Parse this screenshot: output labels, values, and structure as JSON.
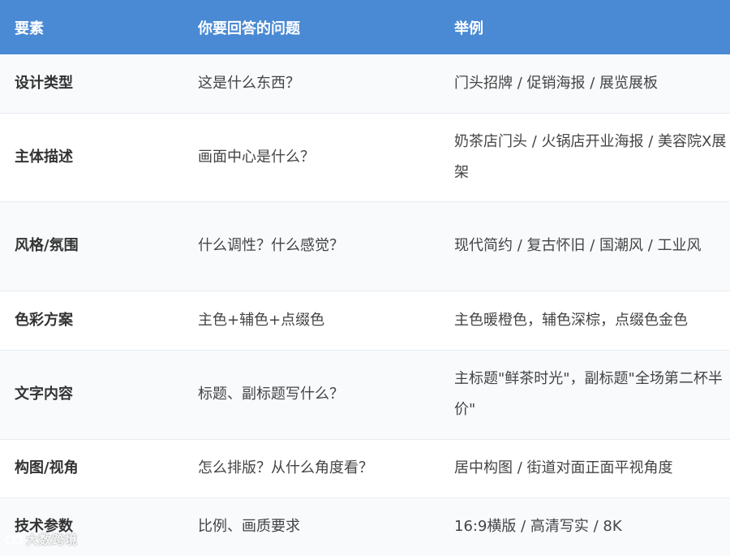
{
  "table": {
    "headers": [
      "要素",
      "你要回答的问题",
      "举例"
    ],
    "rows": [
      {
        "element": "设计类型",
        "question": "这是什么东西？",
        "example": "门头招牌 / 促销海报 / 展览展板"
      },
      {
        "element": "主体描述",
        "question": "画面中心是什么？",
        "example": "奶茶店门头 / 火锅店开业海报 / 美容院X展架"
      },
      {
        "element": "风格/氛围",
        "question": "什么调性？什么感觉？",
        "example": "现代简约 / 复古怀旧 / 国潮风 / 工业风"
      },
      {
        "element": "色彩方案",
        "question": "主色+辅色+点缀色",
        "example": "主色暖橙色，辅色深棕，点缀色金色"
      },
      {
        "element": "文字内容",
        "question": "标题、副标题写什么？",
        "example": "主标题\"鲜茶时光\"，副标题\"全场第二杯半价\""
      },
      {
        "element": "构图/视角",
        "question": "怎么排版？从什么角度看？",
        "example": "居中构图 / 街道对面正面平视角度"
      },
      {
        "element": "技术参数",
        "question": "比例、画质要求",
        "example": "16:9横版 / 高清写实 / 8K"
      }
    ]
  },
  "watermark": {
    "text": "大数跨境",
    "icon": "logo-icon"
  }
}
